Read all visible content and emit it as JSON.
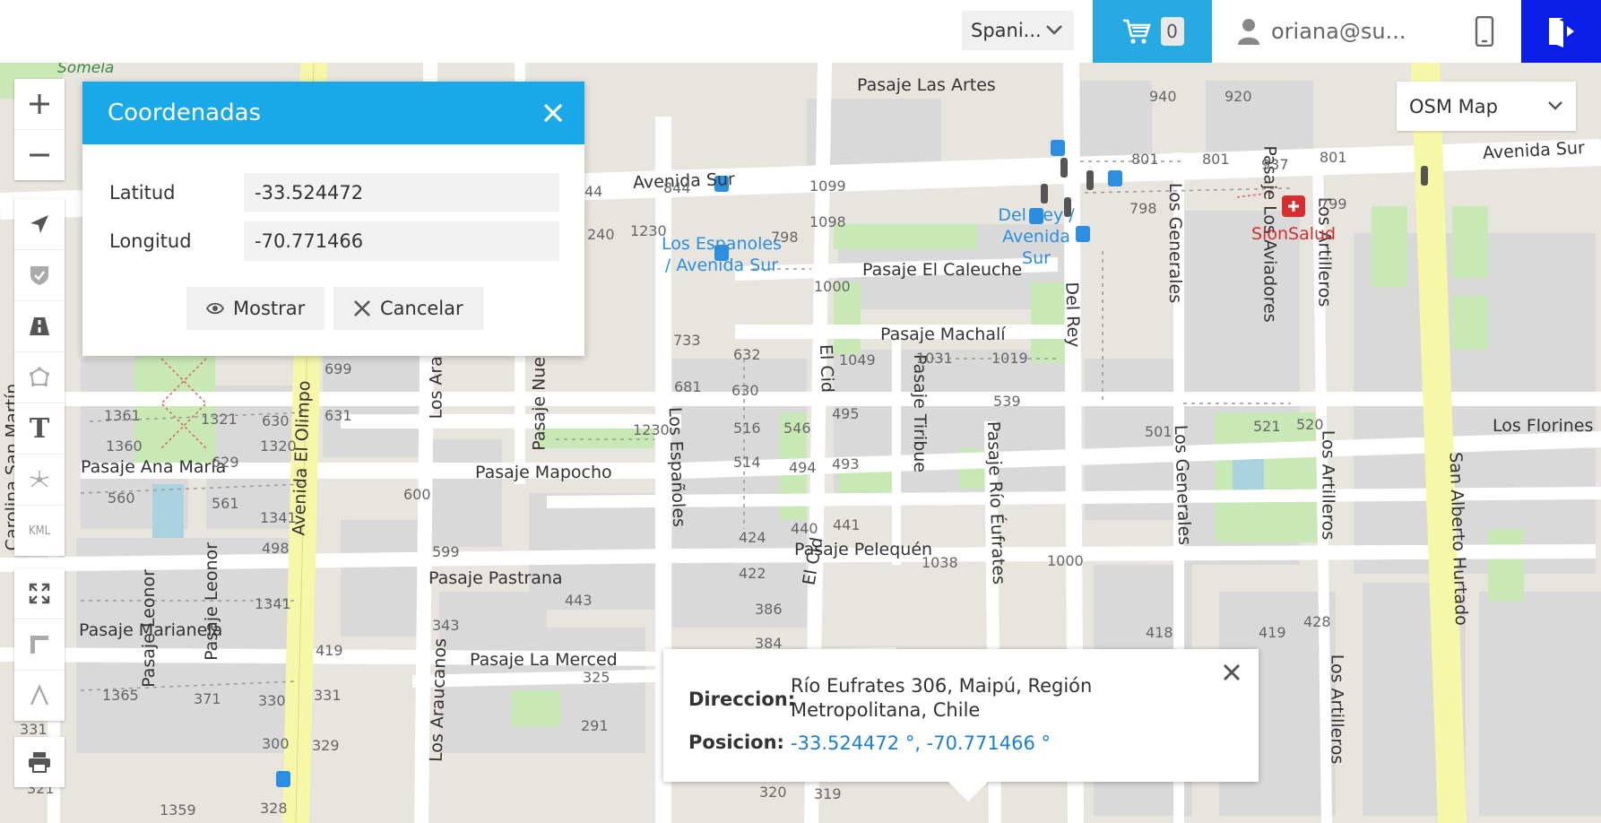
{
  "topbar": {
    "language_selected": "Spani...",
    "cart_count": "0",
    "user_email": "oriana@su..."
  },
  "map": {
    "base_layer_selected": "OSM Map",
    "streets": [
      {
        "name": "Pasaje Las Artes"
      },
      {
        "name": "Avenida Sur"
      },
      {
        "name": "Avenida Sur"
      },
      {
        "name": "Pasaje El Caleuche"
      },
      {
        "name": "Pasaje Machalí"
      },
      {
        "name": "Pasaje Mapocho"
      },
      {
        "name": "Pasaje Ana María"
      },
      {
        "name": "Pasaje Pastrana"
      },
      {
        "name": "Pasaje Marianela"
      },
      {
        "name": "Pasaje La Merced"
      },
      {
        "name": "Pasaje Pelequén"
      },
      {
        "name": "Los Florines"
      },
      {
        "name": "Avenida El Olimpo"
      },
      {
        "name": "Los Araucanos"
      },
      {
        "name": "Pasaje Nuevo Extre"
      },
      {
        "name": "Los Españoles"
      },
      {
        "name": "El Cid"
      },
      {
        "name": "El Cid"
      },
      {
        "name": "Pasaje Tiribue"
      },
      {
        "name": "Pasaje Río Éufrates"
      },
      {
        "name": "Del Rey"
      },
      {
        "name": "Los Generales"
      },
      {
        "name": "Los Generales"
      },
      {
        "name": "Pasaje Los Aviadores"
      },
      {
        "name": "Los Artilleros"
      },
      {
        "name": "Los Artilleros"
      },
      {
        "name": "Los Artilleros"
      },
      {
        "name": "San Alberto Hurtado"
      },
      {
        "name": "Pasaje Leonor"
      },
      {
        "name": "Pasaje Leonor"
      },
      {
        "name": "Carolina San Martín"
      },
      {
        "name": "Los Arauc"
      },
      {
        "name": "Somela"
      }
    ],
    "pois": [
      {
        "name": "Los Espanoles / Avenida Sur"
      },
      {
        "name": "Del Rey / Avenida Sur"
      },
      {
        "name": "SionSalud"
      }
    ],
    "house_numbers": [
      {
        "n": "844"
      },
      {
        "n": "1099"
      },
      {
        "n": "1098"
      },
      {
        "n": "798"
      },
      {
        "n": "1230"
      },
      {
        "n": "240"
      },
      {
        "n": "940"
      },
      {
        "n": "920"
      },
      {
        "n": "801"
      },
      {
        "n": "801"
      },
      {
        "n": "937"
      },
      {
        "n": "801"
      },
      {
        "n": "798"
      },
      {
        "n": "799"
      },
      {
        "n": "1000"
      },
      {
        "n": "733"
      },
      {
        "n": "632"
      },
      {
        "n": "630"
      },
      {
        "n": "681"
      },
      {
        "n": "1049"
      },
      {
        "n": "1031"
      },
      {
        "n": "1019"
      },
      {
        "n": "539"
      },
      {
        "n": "495"
      },
      {
        "n": "516"
      },
      {
        "n": "546"
      },
      {
        "n": "514"
      },
      {
        "n": "494"
      },
      {
        "n": "493"
      },
      {
        "n": "1230"
      },
      {
        "n": "424"
      },
      {
        "n": "440"
      },
      {
        "n": "441"
      },
      {
        "n": "1038"
      },
      {
        "n": "1000"
      },
      {
        "n": "422"
      },
      {
        "n": "386"
      },
      {
        "n": "384"
      },
      {
        "n": "501"
      },
      {
        "n": "521"
      },
      {
        "n": "520"
      },
      {
        "n": "418"
      },
      {
        "n": "419"
      },
      {
        "n": "428"
      },
      {
        "n": "699"
      },
      {
        "n": "631"
      },
      {
        "n": "1361"
      },
      {
        "n": "1321"
      },
      {
        "n": "630"
      },
      {
        "n": "1360"
      },
      {
        "n": "1320"
      },
      {
        "n": "629"
      },
      {
        "n": "560"
      },
      {
        "n": "561"
      },
      {
        "n": "1341"
      },
      {
        "n": "498"
      },
      {
        "n": "600"
      },
      {
        "n": "599"
      },
      {
        "n": "1341"
      },
      {
        "n": "443"
      },
      {
        "n": "343"
      },
      {
        "n": "325"
      },
      {
        "n": "419"
      },
      {
        "n": "1365"
      },
      {
        "n": "371"
      },
      {
        "n": "330"
      },
      {
        "n": "331"
      },
      {
        "n": "291"
      },
      {
        "n": "331"
      },
      {
        "n": "300"
      },
      {
        "n": "329"
      },
      {
        "n": "321"
      },
      {
        "n": "1359"
      },
      {
        "n": "328"
      },
      {
        "n": "320"
      },
      {
        "n": "319"
      },
      {
        "n": "44"
      }
    ]
  },
  "coordinates_dialog": {
    "title": "Coordenadas",
    "lat_label": "Latitud",
    "lat_value": "-33.524472",
    "lon_label": "Longitud",
    "lon_value": "-70.771466",
    "show_label": "Mostrar",
    "cancel_label": "Cancelar"
  },
  "info_popup": {
    "address_label": "Direccion:",
    "address_line1": "Río Eufrates 306, Maipú, Región",
    "address_line2": "Metropolitana, Chile",
    "position_label": "Posicion:",
    "position_value": "-33.524472 °, -70.771466 °"
  },
  "toolbar": {
    "kml_label": "KML",
    "text_tool_label": "T"
  },
  "colors": {
    "accent_blue": "#1aa9e8",
    "cart_blue": "#27a9e1",
    "logout_blue": "#0a1ee8",
    "link_blue": "#1b7fd1",
    "poi_red": "#d42e2e"
  }
}
